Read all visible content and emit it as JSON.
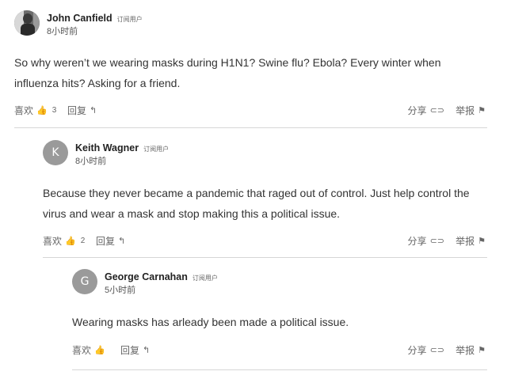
{
  "comments": [
    {
      "author": "John Canfield",
      "badge": "订阅用户",
      "time": "8小时前",
      "avatar": "",
      "text": "So why weren’t we wearing masks during H1N1? Swine flu? Ebola? Every winter when influenza hits? Asking for a friend.",
      "like_label": "喜欢",
      "like_count": "3",
      "reply_label": "回复",
      "share_label": "分享",
      "report_label": "举报"
    },
    {
      "author": "Keith Wagner",
      "badge": "订阅用户",
      "time": "8小时前",
      "avatar": "K",
      "text": "Because they never became a pandemic that raged out of control. Just help control the virus and wear a  mask and stop making this a political issue.",
      "like_label": "喜欢",
      "like_count": "2",
      "reply_label": "回复",
      "share_label": "分享",
      "report_label": "举报"
    },
    {
      "author": "George Carnahan",
      "badge": "订阅用户",
      "time": "5小时前",
      "avatar": "G",
      "text": "Wearing masks has arleady been made a political issue.",
      "like_label": "喜欢",
      "like_count": "",
      "reply_label": "回复",
      "share_label": "分享",
      "report_label": "举报"
    }
  ],
  "icons": {
    "like": "thumbs-up-icon",
    "reply": "reply-arrow-icon",
    "share": "share-link-icon",
    "report": "flag-icon"
  }
}
